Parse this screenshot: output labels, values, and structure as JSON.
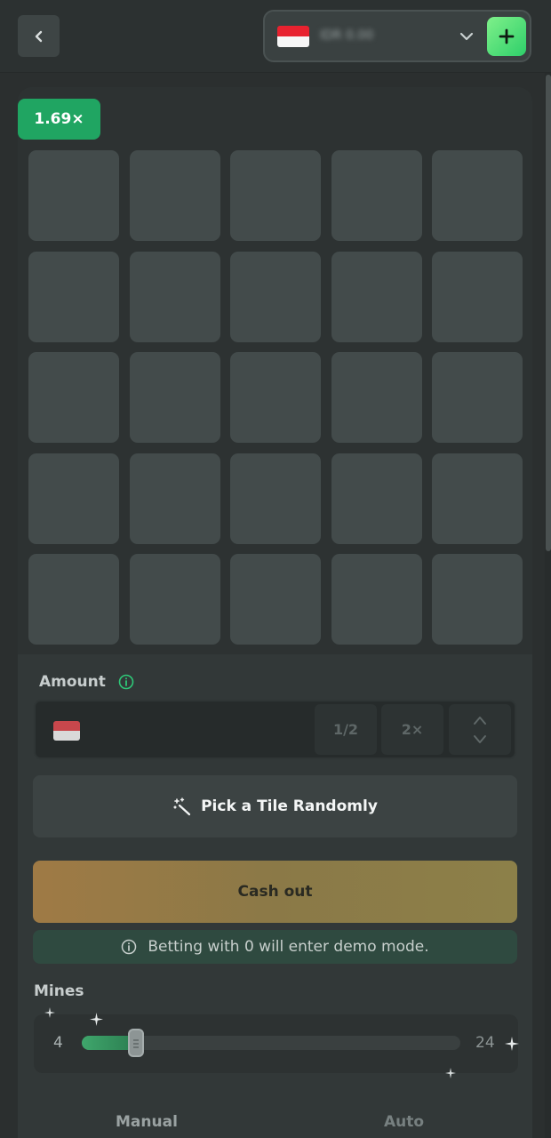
{
  "header": {
    "back_icon": "chevron-left-icon",
    "wallet": {
      "flag": "indonesia-flag",
      "balance": "IDR 0.00",
      "dropdown_icon": "chevron-down-icon",
      "add_icon": "plus-icon"
    }
  },
  "game": {
    "multiplier": "1.69×",
    "grid_rows": 5,
    "grid_cols": 5
  },
  "controls": {
    "amount_label": "Amount",
    "amount_value": "",
    "half_label": "1/2",
    "double_label": "2×",
    "random_label": "Pick a Tile Randomly",
    "cashout_label": "Cash out",
    "demo_note": "Betting with 0 will enter demo mode.",
    "mines_label": "Mines",
    "mines_min": "4",
    "mines_max": "24",
    "mines_value": 4,
    "mines_range": [
      1,
      24
    ]
  },
  "tabs": {
    "manual": "Manual",
    "auto": "Auto"
  },
  "colors": {
    "accent_green": "#20a562",
    "cashout_gold": "#8b7947",
    "tile": "#434b4b"
  }
}
